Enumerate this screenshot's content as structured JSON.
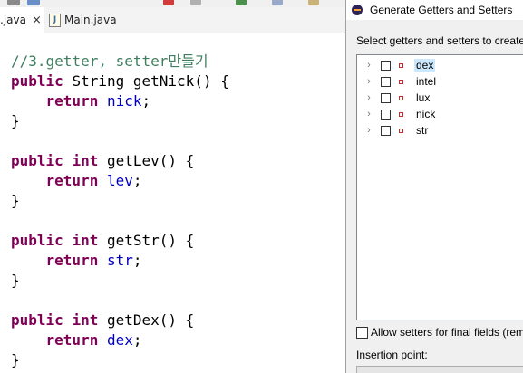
{
  "tabs": [
    {
      "label": ".java",
      "close": "×"
    },
    {
      "label": "Main.java"
    }
  ],
  "code": {
    "comment": "//3.getter, setter만들기",
    "kw_public": "public",
    "kw_return": "return",
    "kw_int": "int",
    "type_string": "String",
    "m1_sig": "getNick() {",
    "m1_field": "nick",
    "m2_sig": "getLev() {",
    "m2_field": "lev",
    "m3_sig": "getStr() {",
    "m3_field": "str",
    "m4_sig": "getDex() {",
    "m4_field": "dex",
    "semicolon": ";",
    "close_brace": "}"
  },
  "dialog": {
    "title": "Generate Getters and Setters",
    "heading": "Select getters and setters to create",
    "fields": [
      {
        "label": "dex",
        "checked": false,
        "selected": true
      },
      {
        "label": "intel",
        "checked": false,
        "selected": false
      },
      {
        "label": "lux",
        "checked": false,
        "selected": false
      },
      {
        "label": "nick",
        "checked": false,
        "selected": false
      },
      {
        "label": "str",
        "checked": false,
        "selected": false
      }
    ],
    "final_setters_label": "Allow setters for final fields (rem",
    "insertion_point_label": "Insertion point:"
  },
  "icons": {
    "tab_close": "close-icon",
    "java_file": "java-file-icon",
    "eclipse": "eclipse-icon",
    "tree_expand": "chevron-right-icon",
    "field": "field-icon"
  },
  "colors": {
    "keyword": "#7f0055",
    "comment": "#3f7f5f",
    "field": "#0000c0",
    "selection": "#cce8ff"
  }
}
